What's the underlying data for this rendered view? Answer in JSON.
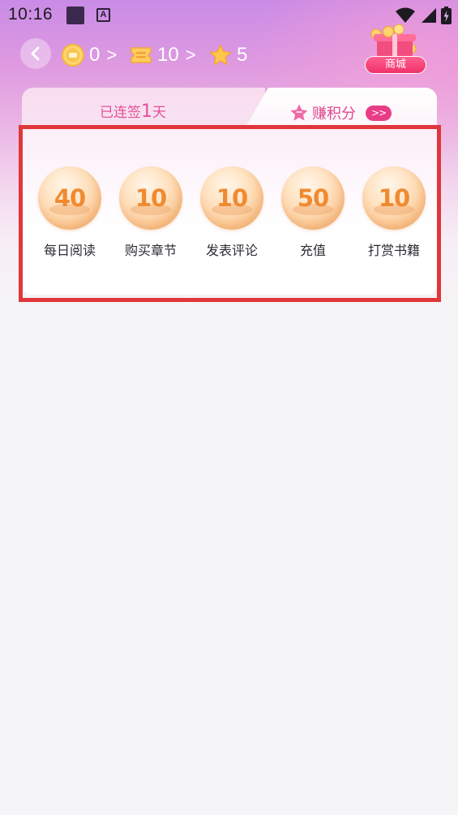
{
  "status_bar": {
    "time": "10:16",
    "a_icon": "A"
  },
  "header": {
    "coins": {
      "icon": "coin-icon",
      "value": "0",
      "chevron": ">"
    },
    "tickets": {
      "icon": "ticket-icon",
      "value": "10",
      "chevron": ">"
    },
    "points": {
      "icon": "star-icon",
      "value": "5"
    },
    "shop_label": "商城"
  },
  "card": {
    "signin_prefix": "已连签",
    "signin_days": "1",
    "signin_suffix": "天",
    "earn_label": "赚积分",
    "earn_arrow": ">>"
  },
  "tasks": [
    {
      "points": "40",
      "label": "每日阅读"
    },
    {
      "points": "10",
      "label": "购买章节"
    },
    {
      "points": "10",
      "label": "发表评论"
    },
    {
      "points": "50",
      "label": "充值"
    },
    {
      "points": "10",
      "label": "打赏书籍"
    }
  ],
  "colors": {
    "accent": "#e83d86",
    "highlight": "#e0373b",
    "coin": "#f08a31"
  }
}
